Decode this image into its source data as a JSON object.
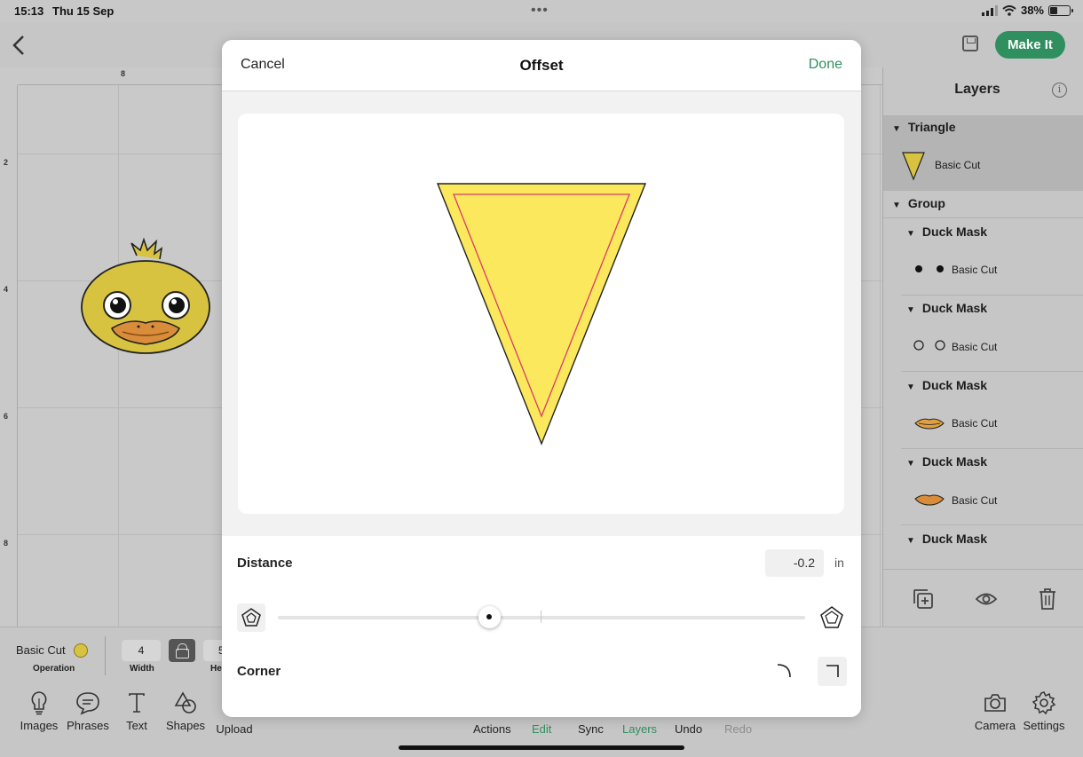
{
  "status": {
    "time": "15:13",
    "date": "Thu 15 Sep",
    "battery": "38%",
    "more": "•••"
  },
  "topbar": {
    "make_it": "Make It"
  },
  "canvas": {
    "ruler_top": [
      "8"
    ],
    "ruler_left": [
      "2",
      "4",
      "6",
      "8"
    ]
  },
  "layers": {
    "title": "Layers",
    "info": "i",
    "groups": [
      {
        "name": "Triangle",
        "items": [
          {
            "label": "Basic Cut",
            "icon": "triangle-thumb"
          }
        ]
      },
      {
        "name": "Group",
        "items": []
      },
      {
        "name": "Duck Mask",
        "items": [
          {
            "label": "Basic Cut",
            "icon": "dots-thumb"
          }
        ]
      },
      {
        "name": "Duck Mask",
        "items": [
          {
            "label": "Basic Cut",
            "icon": "eyes-outline-thumb"
          }
        ]
      },
      {
        "name": "Duck Mask",
        "items": [
          {
            "label": "Basic Cut",
            "icon": "beak-thumb"
          }
        ]
      },
      {
        "name": "Duck Mask",
        "items": [
          {
            "label": "Basic Cut",
            "icon": "beak-orange-thumb"
          }
        ]
      },
      {
        "name": "Duck Mask",
        "items": []
      }
    ]
  },
  "propbar": {
    "operation": "Basic Cut",
    "operation_label": "Operation",
    "width_value": "4",
    "width_label": "Width",
    "height_value": "5",
    "height_label": "Hei"
  },
  "toolbar": {
    "tools": [
      "Images",
      "Phrases",
      "Text",
      "Shapes",
      "Upload"
    ],
    "nav": [
      "Actions",
      "Edit",
      "Sync",
      "Layers",
      "Undo",
      "Redo"
    ],
    "right_tools": [
      "Camera",
      "Settings"
    ]
  },
  "modal": {
    "cancel": "Cancel",
    "title": "Offset",
    "done": "Done",
    "distance_label": "Distance",
    "distance_value": "-0.2",
    "distance_unit": "in",
    "slider_value": -0.2,
    "corner_label": "Corner",
    "accent": "#2f8f5f",
    "shape_fill": "#fce85c",
    "offset_line": "#d63c6b"
  }
}
